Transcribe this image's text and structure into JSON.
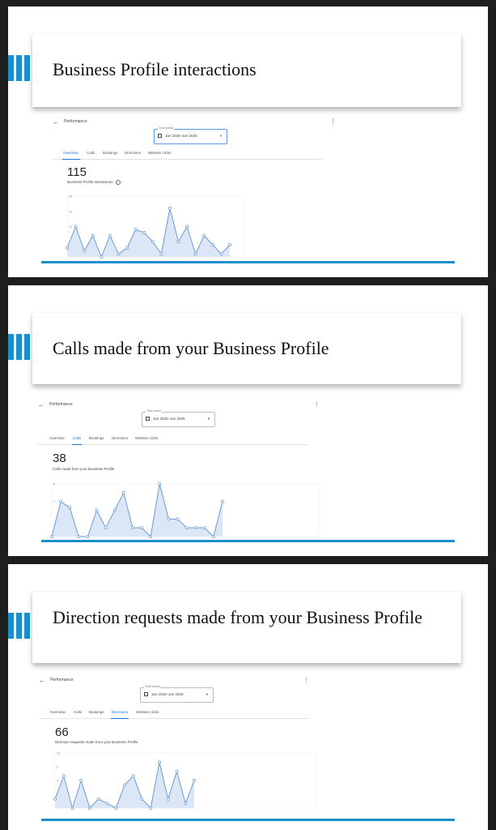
{
  "slides": [
    {
      "title": "Business Profile interactions",
      "screen": {
        "header_title": "Performance",
        "time_period": {
          "label": "Time period",
          "value": "Jan 2025–Jan 2025"
        },
        "tabs": [
          "Overview",
          "Calls",
          "Bookings",
          "Directions",
          "Website clicks"
        ],
        "active_tab": 0,
        "metric_value": "115",
        "metric_label": "Business Profile interactions",
        "chart_data": {
          "type": "area",
          "y_ticks": [
            "20",
            "15",
            "10",
            "5"
          ],
          "ylim": [
            0,
            20
          ],
          "values": [
            3,
            10,
            2,
            7,
            0,
            7,
            1,
            3,
            9,
            8,
            5,
            1,
            16,
            5,
            10,
            1,
            7,
            4,
            1,
            4
          ]
        }
      }
    },
    {
      "title": "Calls made from your Business Profile",
      "screen": {
        "header_title": "Performance",
        "time_period": {
          "label": "Time period",
          "value": "Jan 2025–Jan 2025"
        },
        "tabs": [
          "Overview",
          "Calls",
          "Bookings",
          "Directions",
          "Website clicks"
        ],
        "active_tab": 1,
        "metric_value": "38",
        "metric_label": "Calls made from your Business Profile",
        "chart_data": {
          "type": "area",
          "y_ticks": [
            "6",
            "4"
          ],
          "ylim": [
            0,
            6
          ],
          "values": [
            0,
            4,
            3.3,
            0,
            0,
            3,
            1,
            3,
            5,
            1,
            1,
            0,
            6,
            2,
            2,
            1,
            1,
            1,
            0,
            4
          ]
        }
      }
    },
    {
      "title": "Direction requests made from your Business Profile",
      "screen": {
        "header_title": "Performance",
        "time_period": {
          "label": "Time period",
          "value": "Jan 2025–Jan 2025"
        },
        "tabs": [
          "Overview",
          "Calls",
          "Bookings",
          "Directions",
          "Website clicks"
        ],
        "active_tab": 3,
        "metric_value": "66",
        "metric_label": "Direction requests made from your Business Profile",
        "chart_data": {
          "type": "area",
          "y_ticks": [
            "12",
            "9",
            "6",
            "3"
          ],
          "ylim": [
            0,
            12
          ],
          "values": [
            2,
            7,
            0,
            6,
            0,
            2,
            1,
            0,
            5,
            7,
            2,
            0,
            10,
            2,
            8,
            1,
            6
          ]
        }
      }
    }
  ],
  "colors": {
    "accent": "#1a8fd0",
    "chart_line": "#6b9bd1",
    "chart_fill": "#dbe7f7",
    "tab_active": "#1a73e8"
  }
}
